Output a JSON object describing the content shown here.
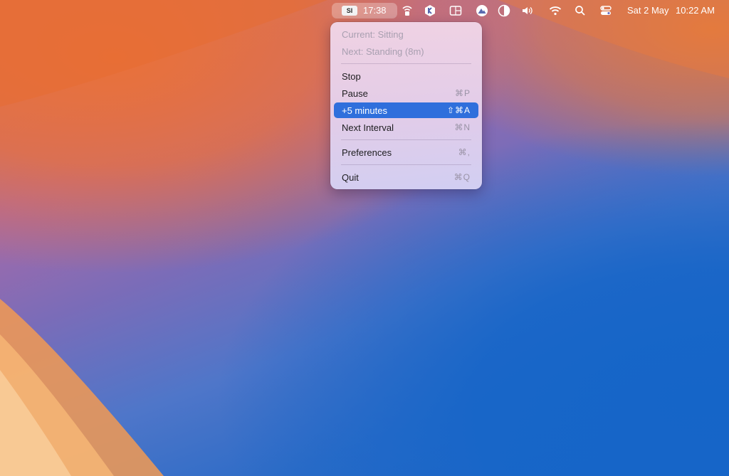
{
  "menubar": {
    "app_badge": "SI",
    "app_timer": "17:38",
    "status_icons": [
      "wifi-lock-icon",
      "k-app-icon",
      "window-layout-icon",
      "mountain-app-icon",
      "half-circle-icon",
      "volume-icon",
      "wifi-icon",
      "search-icon",
      "control-center-icon"
    ],
    "date": "Sat 2 May",
    "time": "10:22 AM"
  },
  "menu": {
    "status_current": "Current: Sitting",
    "status_next": "Next: Standing (8m)",
    "items": [
      {
        "label": "Stop",
        "shortcut": ""
      },
      {
        "label": "Pause",
        "shortcut": "⌘P"
      },
      {
        "label": "+5 minutes",
        "shortcut": "⇧⌘A"
      },
      {
        "label": "Next Interval",
        "shortcut": "⌘N"
      },
      {
        "label": "Preferences",
        "shortcut": "⌘,"
      },
      {
        "label": "Quit",
        "shortcut": "⌘Q"
      }
    ],
    "highlighted_item": "+5 minutes"
  },
  "colors": {
    "highlight": "#2f6fdc",
    "wallpaper_warm": "#e9713a",
    "wallpaper_cool": "#1565c8"
  }
}
